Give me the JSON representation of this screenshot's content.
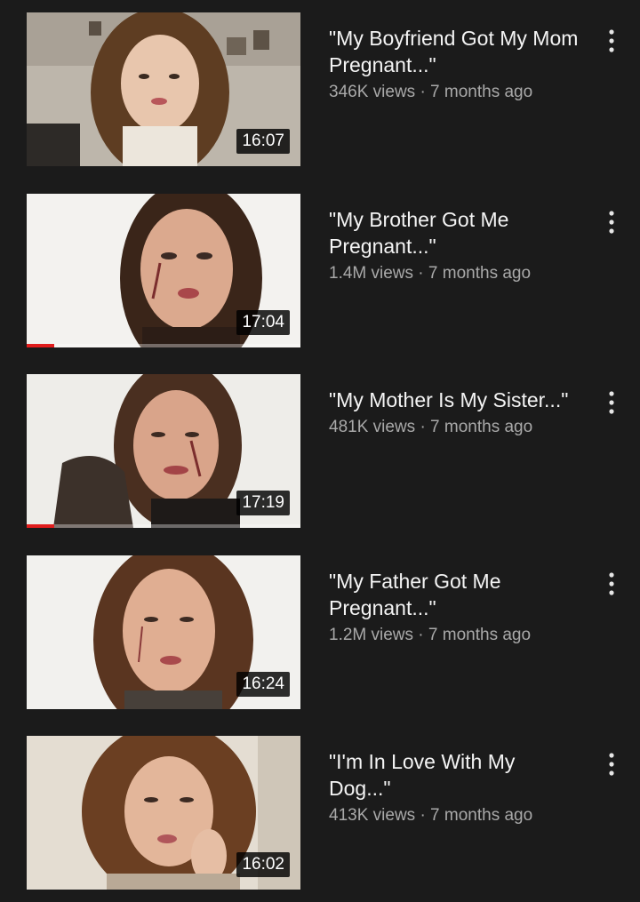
{
  "videos": [
    {
      "title": "\"My Boyfriend Got My Mom Pregnant...\"",
      "views": "346K views",
      "age": "7 months ago",
      "stats": "346K views · 7 months ago",
      "duration": "16:07",
      "watched_fraction": 0
    },
    {
      "title": "\"My Brother Got Me Pregnant...\"",
      "views": "1.4M views",
      "age": "7 months ago",
      "stats": "1.4M views · 7 months ago",
      "duration": "17:04",
      "watched_fraction": 0.1
    },
    {
      "title": "\"My Mother Is My Sister...\"",
      "views": "481K views",
      "age": "7 months ago",
      "stats": "481K views · 7 months ago",
      "duration": "17:19",
      "watched_fraction": 0.1
    },
    {
      "title": "\"My Father Got Me Pregnant...\"",
      "views": "1.2M views",
      "age": "7 months ago",
      "stats": "1.2M views · 7 months ago",
      "duration": "16:24",
      "watched_fraction": 0
    },
    {
      "title": "\"I'm In Love With My Dog...\"",
      "views": "413K views",
      "age": "7 months ago",
      "stats": "413K views · 7 months ago",
      "duration": "16:02",
      "watched_fraction": 0
    }
  ],
  "icons": {
    "menu": "more-vertical-icon"
  },
  "colors": {
    "background": "#1b1b1b",
    "title": "#f4f4f4",
    "stats": "#a9a9a9",
    "progress": "#e11d1d"
  }
}
